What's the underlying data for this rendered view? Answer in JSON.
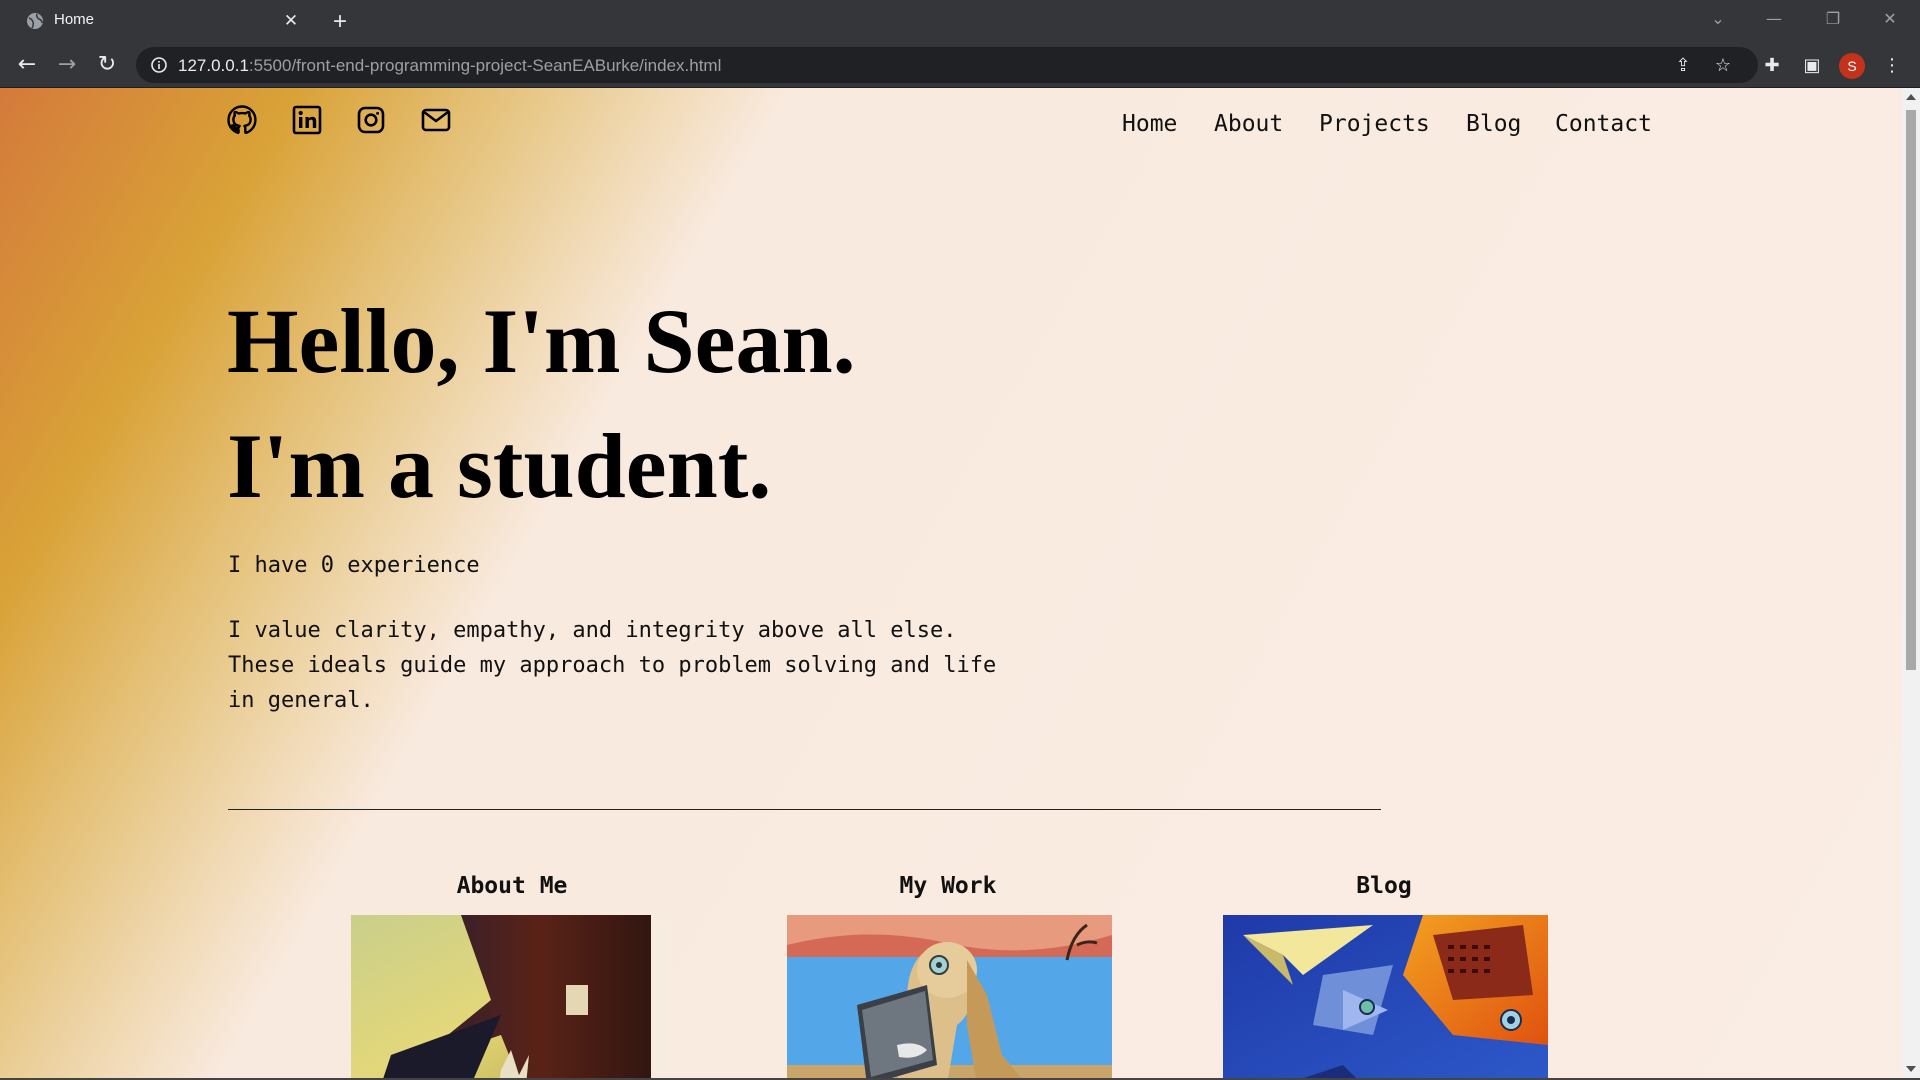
{
  "browser": {
    "tab_title": "Home",
    "url_host": "127.0.0.1",
    "url_path": ":5500/front-end-programming-project-SeanEABurke/index.html",
    "profile_initial": "S"
  },
  "nav": {
    "items": [
      "Home",
      "About",
      "Projects",
      "Blog",
      "Contact"
    ]
  },
  "hero": {
    "line1": "Hello, I'm Sean.",
    "line2": "I'm a student."
  },
  "intro": {
    "experience": "I have 0 experience",
    "values": "I value clarity, empathy, and integrity above all else. These ideals guide my approach to problem solving and life in general."
  },
  "cards": [
    {
      "title": "About Me"
    },
    {
      "title": "My Work"
    },
    {
      "title": "Blog"
    }
  ],
  "social_icons": [
    "github-icon",
    "linkedin-icon",
    "instagram-icon",
    "mail-icon"
  ],
  "colors": {
    "page_bg": "#faede4",
    "gradient_orange": "#d47a3b",
    "gradient_gold": "#d9a237",
    "chrome_dark": "#35363a",
    "profile_red": "#c4321c"
  }
}
